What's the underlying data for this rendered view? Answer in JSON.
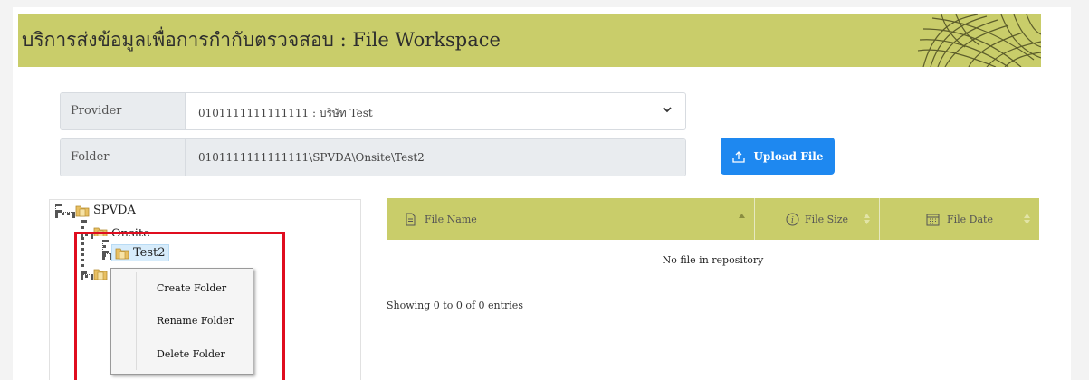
{
  "header": {
    "title": "บริการส่งข้อมูลเพื่อการกำกับตรวจสอบ : File Workspace"
  },
  "form": {
    "provider_label": "Provider",
    "provider_value": "0101111111111111 : บริษัท Test",
    "folder_label": "Folder",
    "folder_value": "0101111111111111\\SPVDA\\Onsite\\Test2"
  },
  "upload_button": {
    "label": "Upload File",
    "icon": "upload-icon"
  },
  "tree": {
    "root": "SPVDA",
    "child": "Onsite",
    "selected": "Test2"
  },
  "context_menu": {
    "items": [
      "Create Folder",
      "Rename Folder",
      "Delete Folder"
    ]
  },
  "table": {
    "columns": [
      {
        "label": "File Name",
        "icon": "file-icon"
      },
      {
        "label": "File Size",
        "icon": "info-icon"
      },
      {
        "label": "File Date",
        "icon": "calendar-icon"
      }
    ],
    "empty_message": "No file in repository",
    "info": "Showing 0 to 0 of 0 entries"
  },
  "colors": {
    "header_bg": "#c9cd6a",
    "primary_button": "#1e88f0",
    "highlight_border": "#e00d1f",
    "selected_node_bg": "#d7ecfb"
  }
}
